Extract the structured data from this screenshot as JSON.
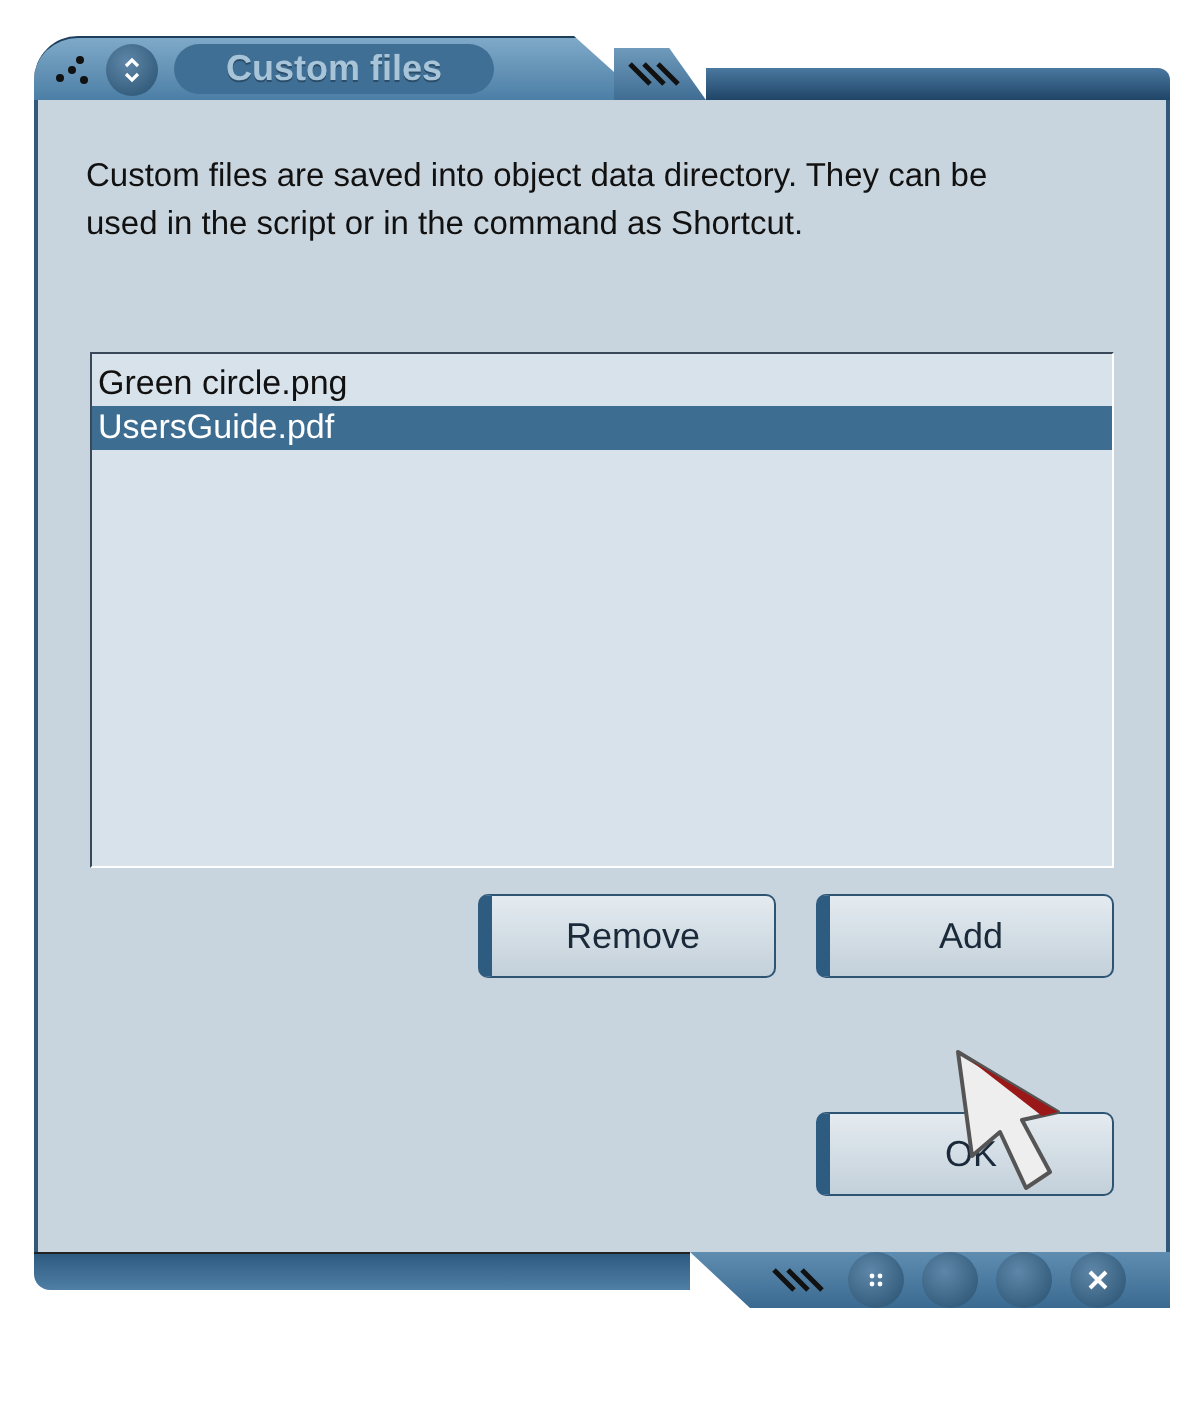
{
  "window": {
    "title": "Custom files"
  },
  "description": "Custom files are saved into object data directory. They can be used in the script or in the command as Shortcut.",
  "files": [
    {
      "name": "Green circle.png",
      "selected": false
    },
    {
      "name": "UsersGuide.pdf",
      "selected": true
    }
  ],
  "buttons": {
    "remove": "Remove",
    "add": "Add",
    "ok": "OK"
  }
}
